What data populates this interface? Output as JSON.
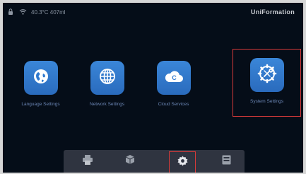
{
  "status_bar": {
    "info_text": "40.3°C 407ml",
    "brand": "UniFormation",
    "icons": [
      "lock-icon",
      "wifi-icon"
    ]
  },
  "apps": [
    {
      "label": "Language Settings",
      "icon": "globe-icon",
      "selected": false
    },
    {
      "label": "Network Settings",
      "icon": "network-globe-icon",
      "selected": false
    },
    {
      "label": "Cloud Services",
      "icon": "cloud-icon",
      "selected": false
    },
    {
      "label": "System Settings",
      "icon": "gear-icon",
      "selected": true
    }
  ],
  "dock": {
    "items": [
      {
        "icon": "printer-icon",
        "selected": false
      },
      {
        "icon": "cube-icon",
        "selected": false
      },
      {
        "icon": "settings-icon",
        "selected": true
      },
      {
        "icon": "file-icon",
        "selected": false
      }
    ]
  },
  "colors": {
    "background": "#050d18",
    "tile": "#2f79cf",
    "label": "#6b86b5",
    "highlight": "#d63a3a",
    "dock": "#2f3440"
  }
}
